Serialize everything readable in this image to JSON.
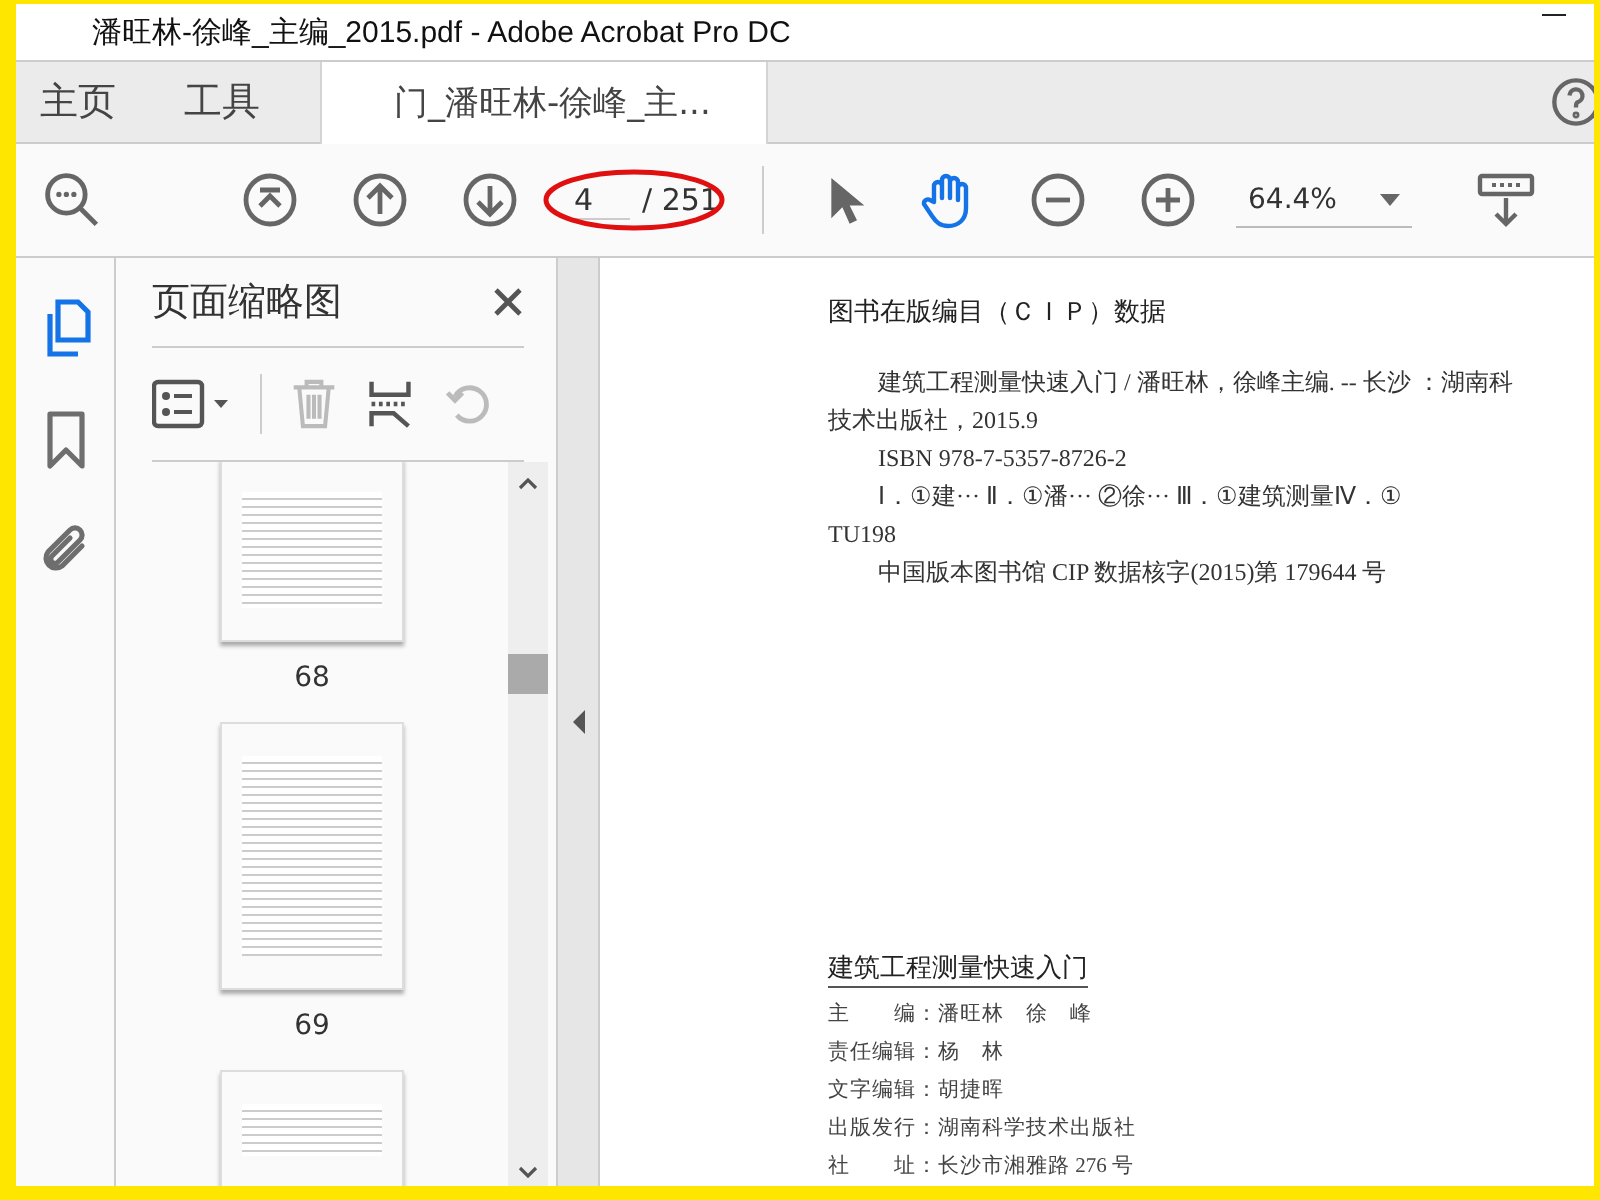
{
  "window": {
    "title": "潘旺林-徐峰_主编_2015.pdf - Adobe Acrobat Pro DC"
  },
  "tabs": [
    {
      "label": "主页",
      "selected": false
    },
    {
      "label": "工具",
      "selected": false
    },
    {
      "label": "门_潘旺林-徐峰_主...",
      "selected": true
    }
  ],
  "toolbar": {
    "page_number": "4",
    "page_count": "/ 251",
    "zoom": "64.4%",
    "tools": [
      {
        "kind": "select",
        "selected": false
      },
      {
        "kind": "hand",
        "selected": true
      }
    ]
  },
  "rail": [
    {
      "kind": "pages",
      "selected": true
    },
    {
      "kind": "bookmarks",
      "selected": false
    },
    {
      "kind": "attachments",
      "selected": false
    }
  ],
  "panel": {
    "title": "页面缩略图",
    "thumbnails": [
      {
        "kind": "cut-top",
        "label": "68"
      },
      {
        "kind": "full",
        "label": "69"
      },
      {
        "kind": "cut-bottom"
      }
    ]
  },
  "document": {
    "cip_heading": "图书在版编目（ＣＩＰ）数据",
    "cip_lines": [
      {
        "kind": "indent",
        "text": "建筑工程测量快速入门 / 潘旺林，徐峰主编. -- 长沙 ：湖南科"
      },
      {
        "kind": "plain",
        "text": "技术出版社，2015.9"
      },
      {
        "kind": "indent",
        "text": "ISBN 978-7-5357-8726-2"
      },
      {
        "kind": "indent",
        "text": "Ⅰ．①建··· Ⅱ．①潘··· ②徐··· Ⅲ．①建筑测量Ⅳ．①"
      },
      {
        "kind": "plain",
        "text": "TU198"
      },
      {
        "kind": "indent",
        "text": "中国版本图书馆 CIP 数据核字(2015)第 179644 号"
      }
    ],
    "book_title": "建筑工程测量快速入门",
    "credits": [
      {
        "label": "主　　编：",
        "value": "潘旺林　徐　峰"
      },
      {
        "label": "责任编辑：",
        "value": "杨　林"
      },
      {
        "label": "文字编辑：",
        "value": "胡捷晖"
      },
      {
        "label": "出版发行：",
        "value": "湖南科学技术出版社"
      },
      {
        "label": "社　　址：",
        "value": "长沙市湘雅路 276 号"
      }
    ]
  }
}
